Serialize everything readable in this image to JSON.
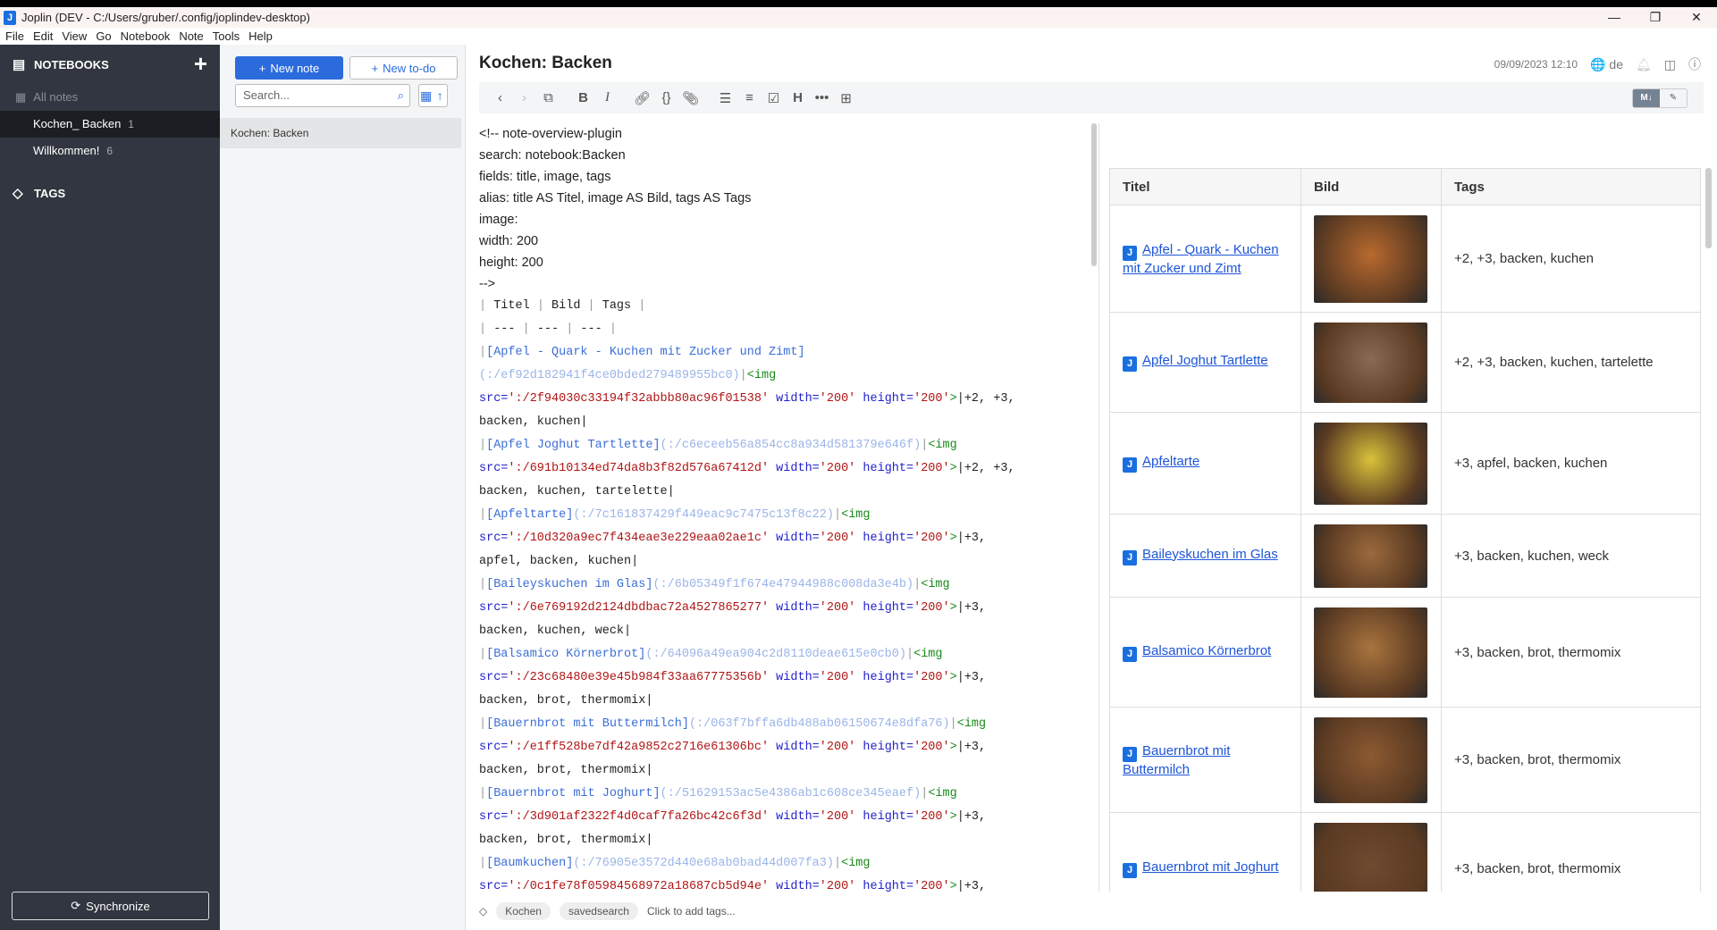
{
  "window": {
    "title": "Joplin (DEV - C:/Users/gruber/.config/joplindev-desktop)"
  },
  "menu": [
    "File",
    "Edit",
    "View",
    "Go",
    "Notebook",
    "Note",
    "Tools",
    "Help"
  ],
  "sidebar": {
    "notebooks_label": "NOTEBOOKS",
    "all_notes": "All notes",
    "items": [
      {
        "label": "Kochen_ Backen",
        "count": "1"
      },
      {
        "label": "Willkommen!",
        "count": "6"
      }
    ],
    "tags_label": "TAGS",
    "sync_label": "Synchronize"
  },
  "notelist": {
    "new_note": "New note",
    "new_todo": "New to-do",
    "search_placeholder": "Search...",
    "notes": [
      "Kochen: Backen"
    ]
  },
  "note": {
    "title": "Kochen: Backen",
    "date": "09/09/2023 12:10",
    "lang": "de",
    "tags": [
      "Kochen",
      "savedsearch"
    ],
    "add_tags": "Click to add tags..."
  },
  "editor": {
    "prose": [
      "<!-- note-overview-plugin",
      "search: notebook:Backen",
      "fields: title, image, tags",
      "alias: title AS Titel, image AS Bild, tags AS Tags",
      "image:",
      "  width: 200",
      "  height: 200",
      "-->"
    ],
    "code": [
      [
        [
          "t-pipe",
          "| "
        ],
        [
          "t-txt",
          "Titel "
        ],
        [
          "t-pipe",
          "| "
        ],
        [
          "t-txt",
          "Bild "
        ],
        [
          "t-pipe",
          "| "
        ],
        [
          "t-txt",
          "Tags "
        ],
        [
          "t-pipe",
          "|"
        ]
      ],
      [
        [
          "t-pipe",
          "| "
        ],
        [
          "t-txt",
          "--- "
        ],
        [
          "t-pipe",
          "| "
        ],
        [
          "t-txt",
          "--- "
        ],
        [
          "t-pipe",
          "| "
        ],
        [
          "t-txt",
          "--- "
        ],
        [
          "t-pipe",
          "|"
        ]
      ],
      [
        [
          "t-pipe",
          "|"
        ],
        [
          "t-link",
          "[Apfel - Quark - Kuchen mit Zucker und Zimt]"
        ]
      ],
      [
        [
          "t-url",
          "(:/ef92d182941f4ce0bded279489955bc0)"
        ],
        [
          "t-pipe",
          "|"
        ],
        [
          "t-tag",
          "<img"
        ]
      ],
      [
        [
          "t-attr",
          "src="
        ],
        [
          "t-str",
          "':/2f94030c33194f32abbb80ac96f01538'"
        ],
        [
          "t-attr",
          " width="
        ],
        [
          "t-str",
          "'200'"
        ],
        [
          "t-attr",
          " height="
        ],
        [
          "t-str",
          "'200'"
        ],
        [
          "t-tag",
          ">"
        ],
        [
          "t-txt",
          "|+2, +3,"
        ]
      ],
      [
        [
          "t-txt",
          "backen, kuchen|"
        ]
      ],
      [
        [
          "t-pipe",
          "|"
        ],
        [
          "t-link",
          "[Apfel Joghut Tartlette]"
        ],
        [
          "t-url",
          "(:/c6eceeb56a854cc8a934d581379e646f)"
        ],
        [
          "t-pipe",
          "|"
        ],
        [
          "t-tag",
          "<img"
        ]
      ],
      [
        [
          "t-attr",
          "src="
        ],
        [
          "t-str",
          "':/691b10134ed74da8b3f82d576a67412d'"
        ],
        [
          "t-attr",
          " width="
        ],
        [
          "t-str",
          "'200'"
        ],
        [
          "t-attr",
          " height="
        ],
        [
          "t-str",
          "'200'"
        ],
        [
          "t-tag",
          ">"
        ],
        [
          "t-txt",
          "|+2, +3,"
        ]
      ],
      [
        [
          "t-txt",
          "backen, kuchen, tartelette|"
        ]
      ],
      [
        [
          "t-pipe",
          "|"
        ],
        [
          "t-link",
          "[Apfeltarte]"
        ],
        [
          "t-url",
          "(:/7c161837429f449eac9c7475c13f8c22)"
        ],
        [
          "t-pipe",
          "|"
        ],
        [
          "t-tag",
          "<img"
        ]
      ],
      [
        [
          "t-attr",
          "src="
        ],
        [
          "t-str",
          "':/10d320a9ec7f434eae3e229eaa02ae1c'"
        ],
        [
          "t-attr",
          " width="
        ],
        [
          "t-str",
          "'200'"
        ],
        [
          "t-attr",
          " height="
        ],
        [
          "t-str",
          "'200'"
        ],
        [
          "t-tag",
          ">"
        ],
        [
          "t-txt",
          "|+3,"
        ]
      ],
      [
        [
          "t-txt",
          "apfel, backen, kuchen|"
        ]
      ],
      [
        [
          "t-pipe",
          "|"
        ],
        [
          "t-link",
          "[Baileyskuchen im Glas]"
        ],
        [
          "t-url",
          "(:/6b05349f1f674e47944988c008da3e4b)"
        ],
        [
          "t-pipe",
          "|"
        ],
        [
          "t-tag",
          "<img"
        ]
      ],
      [
        [
          "t-attr",
          "src="
        ],
        [
          "t-str",
          "':/6e769192d2124dbdbac72a4527865277'"
        ],
        [
          "t-attr",
          " width="
        ],
        [
          "t-str",
          "'200'"
        ],
        [
          "t-attr",
          " height="
        ],
        [
          "t-str",
          "'200'"
        ],
        [
          "t-tag",
          ">"
        ],
        [
          "t-txt",
          "|+3,"
        ]
      ],
      [
        [
          "t-txt",
          "backen, kuchen, weck|"
        ]
      ],
      [
        [
          "t-pipe",
          "|"
        ],
        [
          "t-link",
          "[Balsamico Körnerbrot]"
        ],
        [
          "t-url",
          "(:/64096a49ea904c2d8110deae615e0cb0)"
        ],
        [
          "t-pipe",
          "|"
        ],
        [
          "t-tag",
          "<img"
        ]
      ],
      [
        [
          "t-attr",
          "src="
        ],
        [
          "t-str",
          "':/23c68480e39e45b984f33aa67775356b'"
        ],
        [
          "t-attr",
          " width="
        ],
        [
          "t-str",
          "'200'"
        ],
        [
          "t-attr",
          " height="
        ],
        [
          "t-str",
          "'200'"
        ],
        [
          "t-tag",
          ">"
        ],
        [
          "t-txt",
          "|+3,"
        ]
      ],
      [
        [
          "t-txt",
          "backen, brot, thermomix|"
        ]
      ],
      [
        [
          "t-pipe",
          "|"
        ],
        [
          "t-link",
          "[Bauernbrot mit Buttermilch]"
        ],
        [
          "t-url",
          "(:/063f7bffa6db488ab06150674e8dfa76)"
        ],
        [
          "t-pipe",
          "|"
        ],
        [
          "t-tag",
          "<img"
        ]
      ],
      [
        [
          "t-attr",
          "src="
        ],
        [
          "t-str",
          "':/e1ff528be7df42a9852c2716e61306bc'"
        ],
        [
          "t-attr",
          " width="
        ],
        [
          "t-str",
          "'200'"
        ],
        [
          "t-attr",
          " height="
        ],
        [
          "t-str",
          "'200'"
        ],
        [
          "t-tag",
          ">"
        ],
        [
          "t-txt",
          "|+3,"
        ]
      ],
      [
        [
          "t-txt",
          "backen, brot, thermomix|"
        ]
      ],
      [
        [
          "t-pipe",
          "|"
        ],
        [
          "t-link",
          "[Bauernbrot mit Joghurt]"
        ],
        [
          "t-url",
          "(:/51629153ac5e4386ab1c608ce345eaef)"
        ],
        [
          "t-pipe",
          "|"
        ],
        [
          "t-tag",
          "<img"
        ]
      ],
      [
        [
          "t-attr",
          "src="
        ],
        [
          "t-str",
          "':/3d901af2322f4d0caf7fa26bc42c6f3d'"
        ],
        [
          "t-attr",
          " width="
        ],
        [
          "t-str",
          "'200'"
        ],
        [
          "t-attr",
          " height="
        ],
        [
          "t-str",
          "'200'"
        ],
        [
          "t-tag",
          ">"
        ],
        [
          "t-txt",
          "|+3,"
        ]
      ],
      [
        [
          "t-txt",
          "backen, brot, thermomix|"
        ]
      ],
      [
        [
          "t-pipe",
          "|"
        ],
        [
          "t-link",
          "[Baumkuchen]"
        ],
        [
          "t-url",
          "(:/76905e3572d440e68ab0bad44d007fa3)"
        ],
        [
          "t-pipe",
          "|"
        ],
        [
          "t-tag",
          "<img"
        ]
      ],
      [
        [
          "t-attr",
          "src="
        ],
        [
          "t-str",
          "':/0c1fe78f05984568972a18687cb5d94e'"
        ],
        [
          "t-attr",
          " width="
        ],
        [
          "t-str",
          "'200'"
        ],
        [
          "t-attr",
          " height="
        ],
        [
          "t-str",
          "'200'"
        ],
        [
          "t-tag",
          ">"
        ],
        [
          "t-txt",
          "|+3,"
        ]
      ]
    ]
  },
  "viewer": {
    "headers": [
      "Titel",
      "Bild",
      "Tags"
    ],
    "rows": [
      {
        "title": "Apfel - Quark - Kuchen mit Zucker und Zimt",
        "tags": "+2, +3, backen, kuchen",
        "color": "#b8692e"
      },
      {
        "title": "Apfel Joghut Tartlette",
        "tags": "+2, +3, backen, kuchen, tartelette",
        "color": "#8a6a55"
      },
      {
        "title": "Apfeltarte",
        "tags": "+3, apfel, backen, kuchen",
        "color": "#d9c23a"
      },
      {
        "title": "Baileyskuchen im Glas",
        "tags": "+3, backen, kuchen, weck",
        "color": "#9b6a3e"
      },
      {
        "title": "Balsamico Körnerbrot",
        "tags": "+3, backen, brot, thermomix",
        "color": "#a9743e"
      },
      {
        "title": "Bauernbrot mit Buttermilch",
        "tags": "+3, backen, brot, thermomix",
        "color": "#8c5a32"
      },
      {
        "title": "Bauernbrot mit Joghurt",
        "tags": "+3, backen, brot, thermomix",
        "color": "#6e4a30"
      }
    ]
  },
  "colors": {
    "accent": "#2b6bdc",
    "sidebar": "#313640",
    "link": "#1d55d8"
  }
}
